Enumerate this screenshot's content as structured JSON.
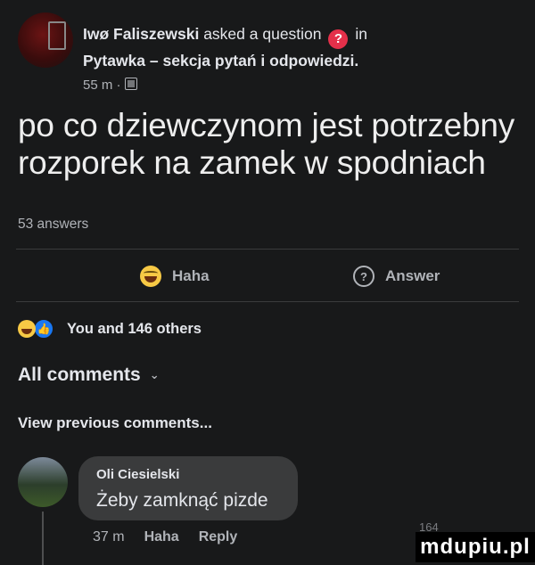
{
  "post": {
    "author": "Iwø Faliszewski",
    "action_text": "asked a question",
    "question_badge": "?",
    "in_text": "in",
    "group": "Pytawka – sekcja pytań i odpowiedzi.",
    "time": "55 m ·",
    "audience_icon": "public-globe-icon",
    "question": "po co dziewczynom jest potrzebny rozporek na zamek w spodniach",
    "answers_count": "53 answers"
  },
  "actions": {
    "haha_label": "Haha",
    "answer_label": "Answer"
  },
  "reactions": {
    "summary": "You and 146 others"
  },
  "comments": {
    "header": "All comments",
    "view_previous": "View previous comments...",
    "items": [
      {
        "author": "Oli Ciesielski",
        "text": "Żeby zamknąć pizde",
        "time": "37 m",
        "haha": "Haha",
        "reply": "Reply",
        "reaction_count": "164"
      }
    ]
  },
  "watermark": "mdupiu.pl",
  "colors": {
    "background": "#18191a",
    "bubble": "#3a3b3c",
    "question_badge": "#e4304a",
    "like_blue": "#1877f2",
    "haha_yellow": "#f7c945"
  }
}
